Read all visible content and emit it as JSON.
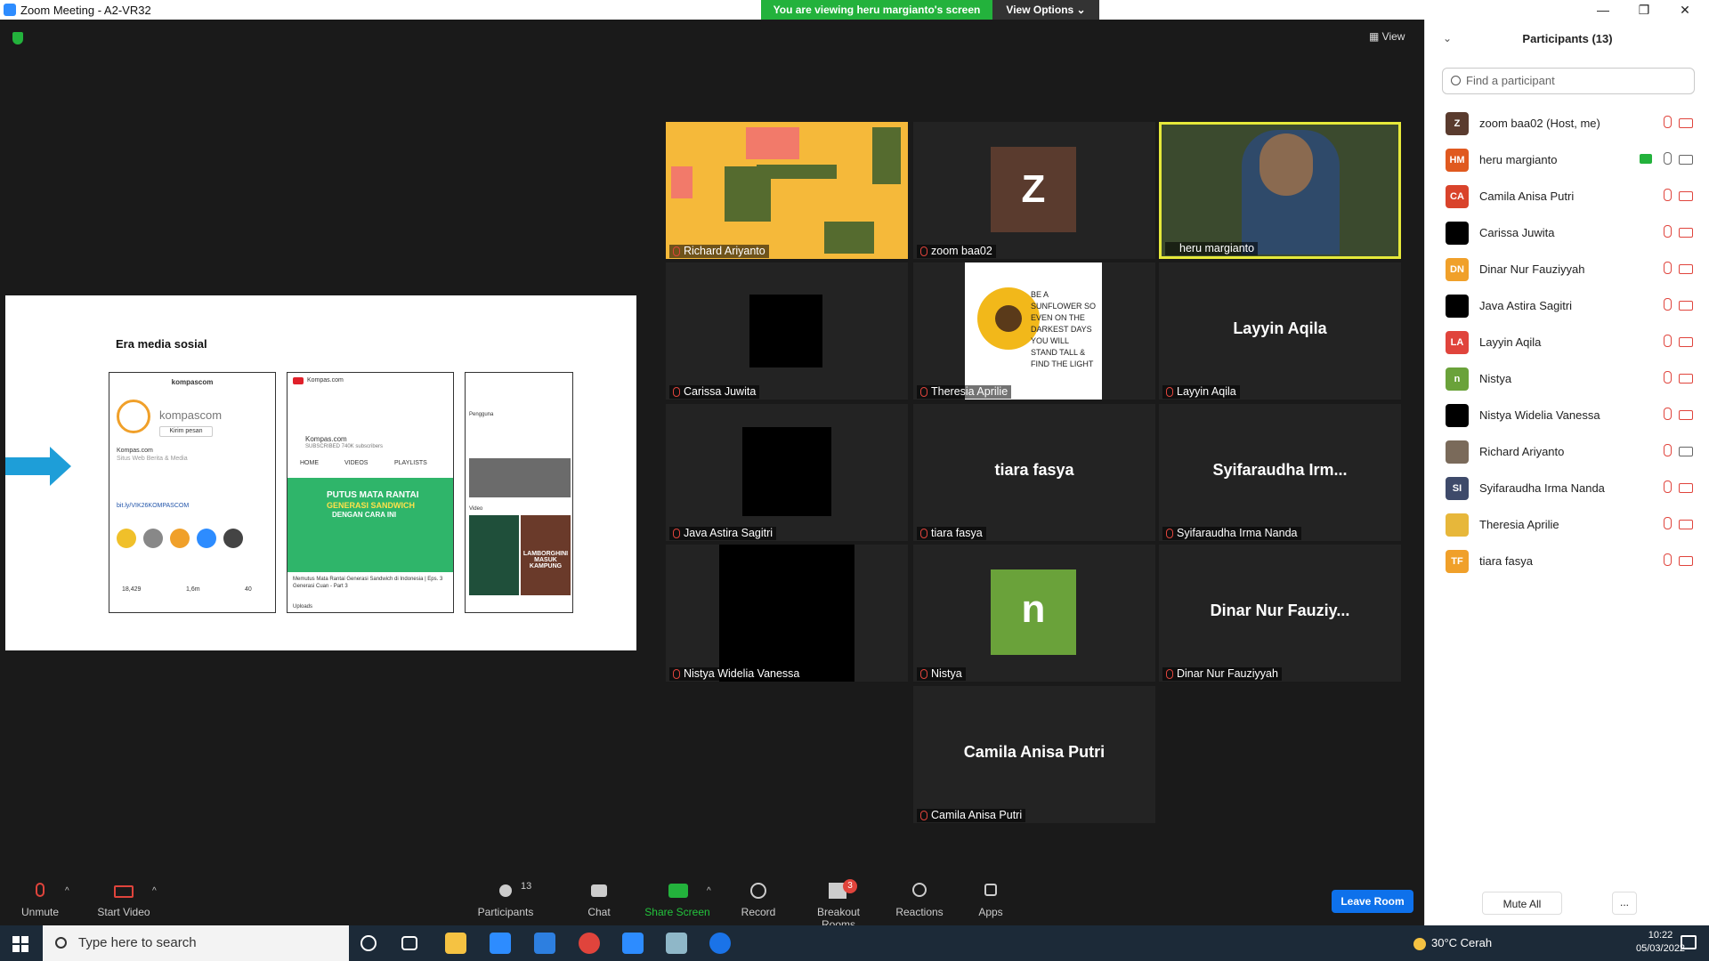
{
  "window": {
    "title": "Zoom Meeting - A2-VR32"
  },
  "share_banner": {
    "viewing": "You are viewing heru margianto's screen",
    "view_options": "View Options ⌄"
  },
  "view_button": "View",
  "slide": {
    "title": "Era media sosial",
    "ig": {
      "handle": "kompascom",
      "name": "kompascom",
      "button": "Kirim pesan",
      "bio1": "Kompas.com",
      "bio2": "Situs Web Berita & Media",
      "link": "bit.ly/VIK26KOMPASCOM",
      "posts": "18,429",
      "followers": "1,6m",
      "following": "40"
    },
    "yt": {
      "brand": "Kompas.com",
      "channel": "Kompas.com",
      "subs": "SUBSCRIBED  740K subscribers",
      "tab_home": "HOME",
      "tab_videos": "VIDEOS",
      "tab_playlists": "PLAYLISTS",
      "headline1": "PUTUS MATA RANTAI",
      "headline2": "GENERASI SANDWICH",
      "headline3": "DENGAN CARA INI",
      "caption": "Memutus Mata Rantai Generasi Sandwich di Indonesia | Eps. 3 Generasi Cuan - Part 3",
      "uploads": "Uploads"
    },
    "tt": {
      "section1": "Pengguna",
      "section2": "Video",
      "label": "LAMBORGHINI MASUK KAMPUNG"
    }
  },
  "tiles": [
    {
      "name": "Richard Ariyanto"
    },
    {
      "name": "zoom baa02",
      "initial": "Z"
    },
    {
      "name": "heru margianto"
    },
    {
      "name": "Carissa Juwita"
    },
    {
      "name": "Theresia Aprilie",
      "quote": "BE A SUNFLOWER SO EVEN ON THE DARKEST DAYS YOU WILL STAND TALL & FIND THE LIGHT"
    },
    {
      "name": "Layyin Aqila",
      "display": "Layyin Aqila"
    },
    {
      "name": "Java Astira Sagitri"
    },
    {
      "name": "tiara fasya",
      "display": "tiara fasya"
    },
    {
      "name": "Syifaraudha Irma Nanda",
      "display": "Syifaraudha  Irm..."
    },
    {
      "name": "Nistya Widelia Vanessa"
    },
    {
      "name": "Nistya",
      "initial": "n"
    },
    {
      "name": "Dinar Nur Fauziyyah",
      "display": "Dinar  Nur  Fauziy..."
    },
    {
      "name": "Camila Anisa Putri",
      "display": "Camila Anisa Putri"
    }
  ],
  "toolbar": {
    "unmute": "Unmute",
    "start_video": "Start Video",
    "participants": "Participants",
    "participants_count": "13",
    "chat": "Chat",
    "share": "Share Screen",
    "record": "Record",
    "breakout": "Breakout Rooms",
    "breakout_badge": "3",
    "reactions": "Reactions",
    "apps": "Apps",
    "leave": "Leave Room"
  },
  "panel": {
    "title": "Participants (13)",
    "search_placeholder": "Find a participant",
    "mute_all": "Mute All",
    "more": "...",
    "participants": [
      {
        "initials": "Z",
        "name": "zoom baa02 (Host, me)",
        "color": "#5a3b2e"
      },
      {
        "initials": "HM",
        "name": "heru margianto",
        "color": "#e0591f"
      },
      {
        "initials": "CA",
        "name": "Camila Anisa Putri",
        "color": "#d9432b"
      },
      {
        "initials": "",
        "name": "Carissa Juwita",
        "color": "#000000"
      },
      {
        "initials": "DN",
        "name": "Dinar Nur Fauziyyah",
        "color": "#f0a02a"
      },
      {
        "initials": "",
        "name": "Java Astira Sagitri",
        "color": "#000000"
      },
      {
        "initials": "LA",
        "name": "Layyin Aqila",
        "color": "#e0443c"
      },
      {
        "initials": "n",
        "name": "Nistya",
        "color": "#6aa23a"
      },
      {
        "initials": "",
        "name": "Nistya Widelia Vanessa",
        "color": "#000000"
      },
      {
        "initials": "",
        "name": "Richard Ariyanto",
        "color": "#7a6a5a"
      },
      {
        "initials": "SI",
        "name": "Syifaraudha Irma Nanda",
        "color": "#3e4a6a"
      },
      {
        "initials": "",
        "name": "Theresia Aprilie",
        "color": "#e7b73a"
      },
      {
        "initials": "TF",
        "name": "tiara fasya",
        "color": "#f0a02a"
      }
    ]
  },
  "taskbar": {
    "search_placeholder": "Type here to search",
    "weather": "30°C  Cerah",
    "time": "10:22",
    "date": "05/03/2022"
  }
}
